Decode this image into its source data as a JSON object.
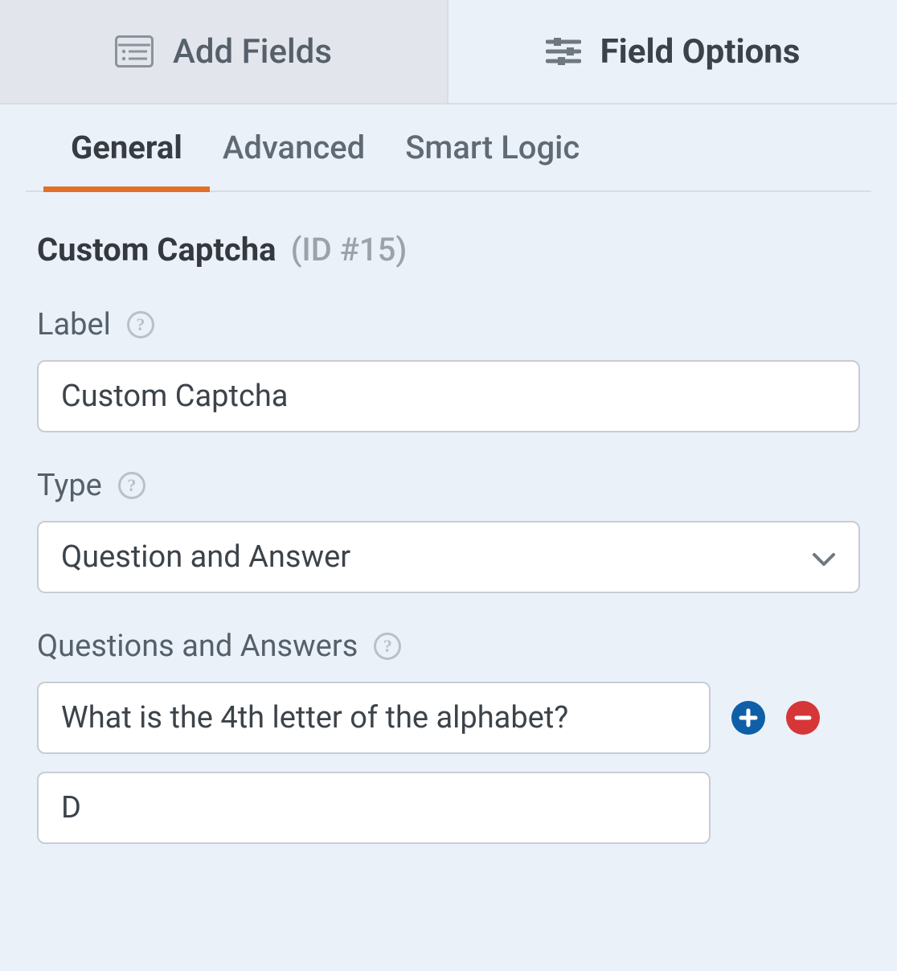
{
  "topTabs": {
    "addFields": "Add Fields",
    "fieldOptions": "Field Options"
  },
  "subTabs": {
    "general": "General",
    "advanced": "Advanced",
    "smartLogic": "Smart Logic"
  },
  "section": {
    "title": "Custom Captcha",
    "idLabel": "(ID #15)"
  },
  "fields": {
    "label": {
      "labelText": "Label",
      "value": "Custom Captcha"
    },
    "type": {
      "labelText": "Type",
      "value": "Question and Answer"
    },
    "qa": {
      "labelText": "Questions and Answers",
      "items": [
        {
          "question": "What is the 4th letter of the alphabet?",
          "answer": "D"
        }
      ]
    }
  }
}
